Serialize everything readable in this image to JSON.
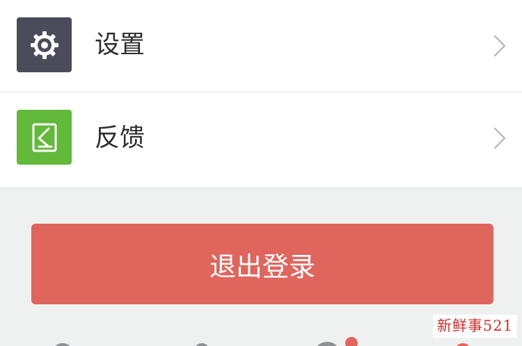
{
  "menu": {
    "items": [
      {
        "label": "设置",
        "icon": "gear-icon",
        "icon_bg": "#4b4b5c"
      },
      {
        "label": "反馈",
        "icon": "feedback-icon",
        "icon_bg": "#63ba3a"
      }
    ]
  },
  "logout": {
    "label": "退出登录",
    "bg": "#e0655d"
  },
  "watermark": "新鲜事521"
}
